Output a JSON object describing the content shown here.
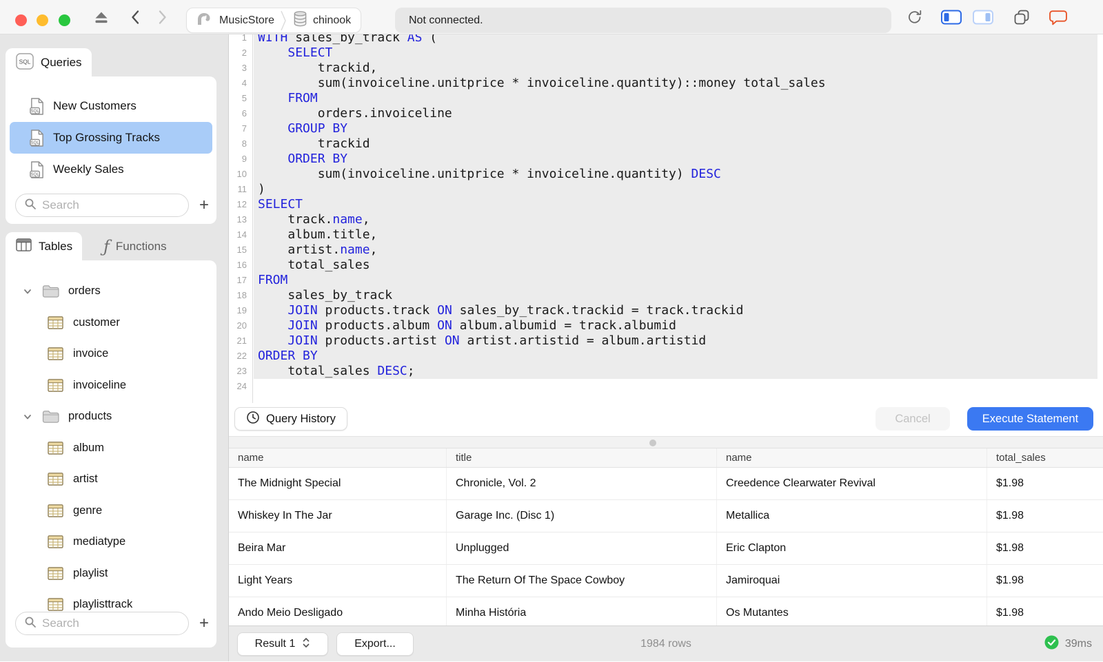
{
  "colors": {
    "accent_blue": "#3B79F2",
    "selection_blue": "#A9CCF8",
    "keyword_blue": "#2323DC",
    "success_green": "#2EC04F",
    "chat_orange": "#E8552A",
    "statement_highlight": "#ECECEC"
  },
  "titlebar": {
    "breadcrumb": [
      {
        "label": "MusicStore",
        "icon": "elephant"
      },
      {
        "label": "chinook",
        "icon": "database"
      }
    ],
    "status_text": "Not connected."
  },
  "sidebar": {
    "queries": {
      "tab_label": "Queries",
      "items": [
        {
          "label": "New Customers",
          "selected": false
        },
        {
          "label": "Top Grossing Tracks",
          "selected": true
        },
        {
          "label": "Weekly Sales",
          "selected": false
        }
      ],
      "search_placeholder": "Search",
      "add_label": "+"
    },
    "tables": {
      "tab_label": "Tables",
      "functions_tab_label": "Functions",
      "groups": [
        {
          "label": "orders",
          "expanded": true,
          "children": [
            "customer",
            "invoice",
            "invoiceline"
          ]
        },
        {
          "label": "products",
          "expanded": true,
          "children": [
            "album",
            "artist",
            "genre",
            "mediatype",
            "playlist",
            "playlisttrack"
          ]
        }
      ],
      "search_placeholder": "Search",
      "add_label": "+"
    }
  },
  "editor": {
    "lines": [
      [
        {
          "t": "WITH",
          "kw": true
        },
        {
          "t": " sales_by_track ",
          "kw": false
        },
        {
          "t": "AS",
          "kw": true
        },
        {
          "t": " (",
          "kw": false
        }
      ],
      [
        {
          "t": "    ",
          "kw": false
        },
        {
          "t": "SELECT",
          "kw": true
        }
      ],
      [
        {
          "t": "        trackid,",
          "kw": false
        }
      ],
      [
        {
          "t": "        sum(invoiceline.unitprice * invoiceline.quantity)::money total_sales",
          "kw": false
        }
      ],
      [
        {
          "t": "    ",
          "kw": false
        },
        {
          "t": "FROM",
          "kw": true
        }
      ],
      [
        {
          "t": "        orders.invoiceline",
          "kw": false
        }
      ],
      [
        {
          "t": "    ",
          "kw": false
        },
        {
          "t": "GROUP BY",
          "kw": true
        }
      ],
      [
        {
          "t": "        trackid",
          "kw": false
        }
      ],
      [
        {
          "t": "    ",
          "kw": false
        },
        {
          "t": "ORDER BY",
          "kw": true
        }
      ],
      [
        {
          "t": "        sum(invoiceline.unitprice * invoiceline.quantity) ",
          "kw": false
        },
        {
          "t": "DESC",
          "kw": true
        }
      ],
      [
        {
          "t": ")",
          "kw": false
        }
      ],
      [
        {
          "t": "SELECT",
          "kw": true
        }
      ],
      [
        {
          "t": "    track.",
          "kw": false
        },
        {
          "t": "name",
          "kw": true
        },
        {
          "t": ",",
          "kw": false
        }
      ],
      [
        {
          "t": "    album.title,",
          "kw": false
        }
      ],
      [
        {
          "t": "    artist.",
          "kw": false
        },
        {
          "t": "name",
          "kw": true
        },
        {
          "t": ",",
          "kw": false
        }
      ],
      [
        {
          "t": "    total_sales",
          "kw": false
        }
      ],
      [
        {
          "t": "FROM",
          "kw": true
        }
      ],
      [
        {
          "t": "    sales_by_track",
          "kw": false
        }
      ],
      [
        {
          "t": "    ",
          "kw": false
        },
        {
          "t": "JOIN",
          "kw": true
        },
        {
          "t": " products.track ",
          "kw": false
        },
        {
          "t": "ON",
          "kw": true
        },
        {
          "t": " sales_by_track.trackid = track.trackid",
          "kw": false
        }
      ],
      [
        {
          "t": "    ",
          "kw": false
        },
        {
          "t": "JOIN",
          "kw": true
        },
        {
          "t": " products.album ",
          "kw": false
        },
        {
          "t": "ON",
          "kw": true
        },
        {
          "t": " album.albumid = track.albumid",
          "kw": false
        }
      ],
      [
        {
          "t": "    ",
          "kw": false
        },
        {
          "t": "JOIN",
          "kw": true
        },
        {
          "t": " products.artist ",
          "kw": false
        },
        {
          "t": "ON",
          "kw": true
        },
        {
          "t": " artist.artistid = album.artistid",
          "kw": false
        }
      ],
      [
        {
          "t": "ORDER BY",
          "kw": true
        }
      ],
      [
        {
          "t": "    total_sales ",
          "kw": false
        },
        {
          "t": "DESC",
          "kw": true
        },
        {
          "t": ";",
          "kw": false
        }
      ],
      []
    ],
    "query_history_label": "Query History",
    "cancel_label": "Cancel",
    "execute_label": "Execute Statement"
  },
  "results": {
    "columns": [
      "name",
      "title",
      "name",
      "total_sales"
    ],
    "rows": [
      [
        "The Midnight Special",
        "Chronicle, Vol. 2",
        "Creedence Clearwater Revival",
        "$1.98"
      ],
      [
        "Whiskey In The Jar",
        "Garage Inc. (Disc 1)",
        "Metallica",
        "$1.98"
      ],
      [
        "Beira Mar",
        "Unplugged",
        "Eric Clapton",
        "$1.98"
      ],
      [
        "Light Years",
        "The Return Of The Space Cowboy",
        "Jamiroquai",
        "$1.98"
      ],
      [
        "Ando Meio Desligado",
        "Minha História",
        "Os Mutantes",
        "$1.98"
      ]
    ]
  },
  "statusbar": {
    "result_selector": "Result 1",
    "export_label": "Export...",
    "row_count": "1984 rows",
    "duration": "39ms"
  }
}
